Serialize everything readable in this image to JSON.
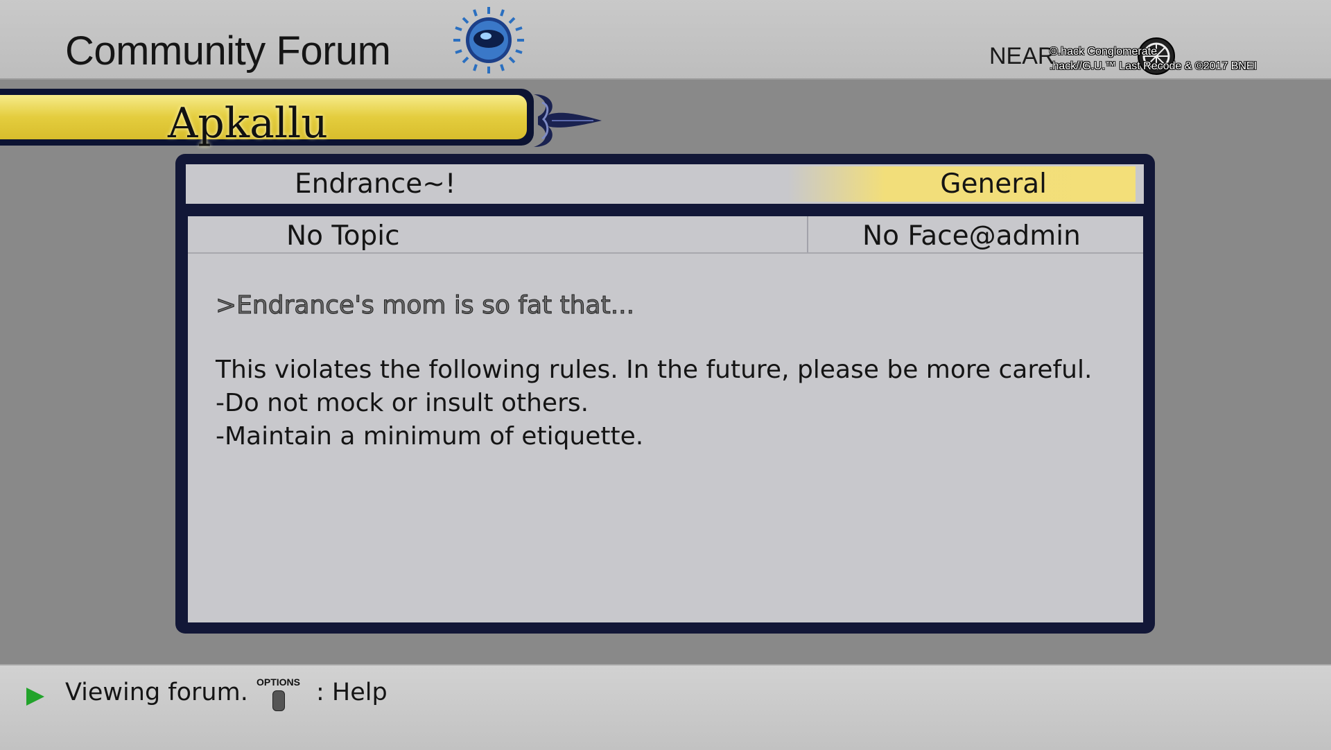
{
  "header": {
    "title": "Community Forum",
    "network_label": "NEAR",
    "copyright_lines": [
      "©.hack Conglomerate",
      ".hack//G.U.™ Last Recode & ©2017 BNEI"
    ]
  },
  "server": {
    "name": "Apkallu"
  },
  "forum": {
    "name": "Endrance~!",
    "category": "General"
  },
  "topic": {
    "title": "No Topic",
    "author": "No Face@admin"
  },
  "post": {
    "quote": ">Endrance's mom is so fat that...",
    "lines": [
      "This violates the following rules. In the future, please be more careful.",
      "-Do not mock or insult others.",
      "-Maintain a minimum of etiquette."
    ]
  },
  "footer": {
    "status": "Viewing forum.",
    "button_label": "OPTIONS",
    "help_label": ": Help"
  },
  "colors": {
    "accent_gold": "#e4cd3e",
    "panel_navy": "#121737",
    "status_green": "#22a32b"
  },
  "icons": [
    "globe-emblem-icon",
    "fleur-de-lis-icon",
    "play-arrow-icon",
    "options-button-icon",
    "conglomerate-logo-icon"
  ]
}
